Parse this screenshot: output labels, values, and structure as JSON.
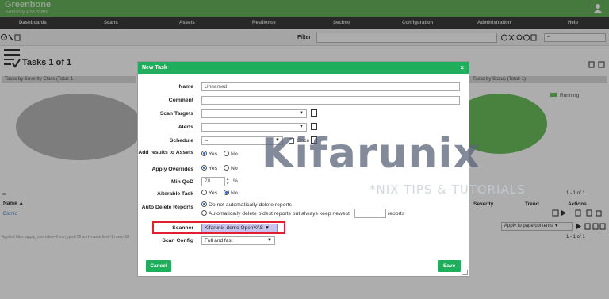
{
  "app": {
    "logo_line1": "Greenbone",
    "logo_line2": "Security Assistant"
  },
  "menu": [
    "Dashboards",
    "Scans",
    "Assets",
    "Resilience",
    "SecInfo",
    "Configuration",
    "Administration",
    "Help"
  ],
  "toolbar": {
    "filter_label": "Filter",
    "filter_select": "--"
  },
  "page": {
    "title": "Tasks 1 of 1"
  },
  "charts": {
    "left_title": "Tasks by Severity Class (Total: 1",
    "right_title": "Tasks by Status (Total: 1)",
    "legend_running": "Running",
    "colors": {
      "severity_pie": "#b8b8b8",
      "status_pie": "#6cbf5e"
    }
  },
  "table": {
    "col_name": "Name ▲",
    "row_name": "Bionic",
    "col_severity": "Severity",
    "col_trend": "Trend",
    "col_actions": "Actions",
    "pagination_top": "1 - 1 of 1",
    "pagination_bottom": "1 - 1 of 1",
    "apply_to": "Apply to page contents",
    "filter_text": "Applied filter: apply_overrides=0 min_qod=70 sort=name first=1 rows=10"
  },
  "watermark": {
    "brand": "Kifarunix",
    "tagline": "*NIX TIPS & TUTORIALS"
  },
  "dialog": {
    "title": "New Task",
    "close": "×",
    "name_label": "Name",
    "name_value": "Unnamed",
    "comment_label": "Comment",
    "comment_value": "",
    "scan_targets_label": "Scan Targets",
    "alerts_label": "Alerts",
    "schedule_label": "Schedule",
    "schedule_value": "--",
    "once_label": "Once",
    "add_results_label": "Add results to Assets",
    "apply_overrides_label": "Apply Overrides",
    "min_qod_label": "Min QoD",
    "min_qod_value": "70",
    "min_qod_unit": "%",
    "alterable_label": "Alterable Task",
    "yes": "Yes",
    "no": "No",
    "auto_delete_label": "Auto Delete Reports",
    "auto_delete_opt1": "Do not automatically delete reports",
    "auto_delete_opt2": "Automatically delete oldest reports but always keep newest",
    "auto_delete_keep": "",
    "auto_delete_unit": "reports",
    "scanner_label": "Scanner",
    "scanner_value": "Kifarunix-demo OpenVAS ▼",
    "scan_config_label": "Scan Config",
    "scan_config_value": "Full and fast",
    "cancel": "Cancel",
    "save": "Save",
    "accent": "#1fae5b"
  }
}
